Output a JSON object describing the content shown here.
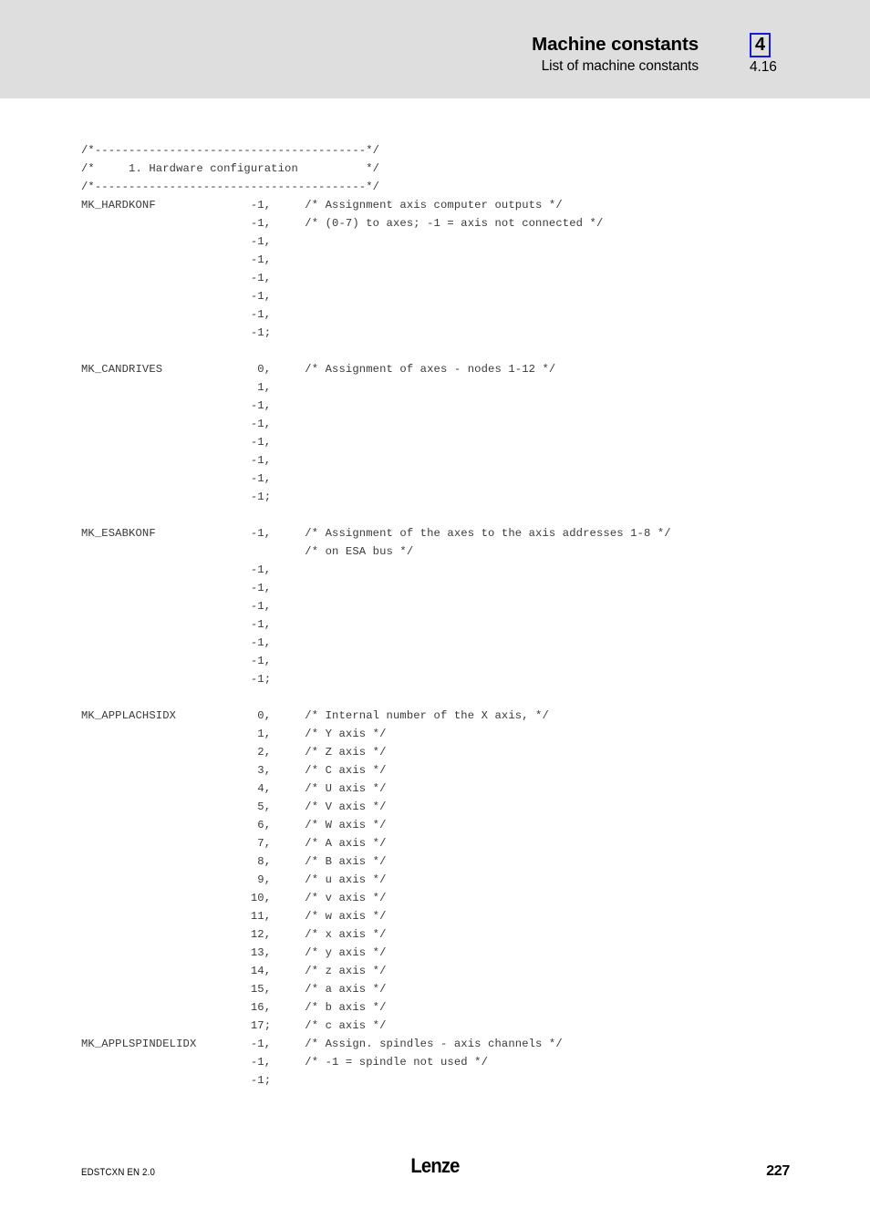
{
  "header": {
    "title": "Machine constants",
    "subtitle": "List of machine constants",
    "chapter_badge": "4",
    "section_number": "4.16",
    "band_color": "#dedede",
    "badge_border_color": "#1818d8"
  },
  "code": {
    "lines": [
      "/*----------------------------------------*/",
      "/*     1. Hardware configuration          */",
      "/*----------------------------------------*/",
      "MK_HARDKONF              -1,     /* Assignment axis computer outputs */",
      "                         -1,     /* (0-7) to axes; -1 = axis not connected */",
      "                         -1,",
      "                         -1,",
      "                         -1,",
      "                         -1,",
      "                         -1,",
      "                         -1;",
      "",
      "MK_CANDRIVES              0,     /* Assignment of axes - nodes 1-12 */",
      "                          1,",
      "                         -1,",
      "                         -1,",
      "                         -1,",
      "                         -1,",
      "                         -1,",
      "                         -1;",
      "",
      "MK_ESABKONF              -1,     /* Assignment of the axes to the axis addresses 1-8 */",
      "                                 /* on ESA bus */",
      "                         -1,",
      "                         -1,",
      "                         -1,",
      "                         -1,",
      "                         -1,",
      "                         -1,",
      "                         -1;",
      "",
      "MK_APPLACHSIDX            0,     /* Internal number of the X axis, */",
      "                          1,     /* Y axis */",
      "                          2,     /* Z axis */",
      "                          3,     /* C axis */",
      "                          4,     /* U axis */",
      "                          5,     /* V axis */",
      "                          6,     /* W axis */",
      "                          7,     /* A axis */",
      "                          8,     /* B axis */",
      "                          9,     /* u axis */",
      "                         10,     /* v axis */",
      "                         11,     /* w axis */",
      "                         12,     /* x axis */",
      "                         13,     /* y axis */",
      "                         14,     /* z axis */",
      "                         15,     /* a axis */",
      "                         16,     /* b axis */",
      "                         17;     /* c axis */",
      "MK_APPLSPINDELIDX        -1,     /* Assign. spindles - axis channels */",
      "                         -1,     /* -1 = spindle not used */",
      "                         -1;"
    ]
  },
  "footer": {
    "doc_id": "EDSTCXN  EN  2.0",
    "logo": "Lenze",
    "page_number": "227"
  }
}
